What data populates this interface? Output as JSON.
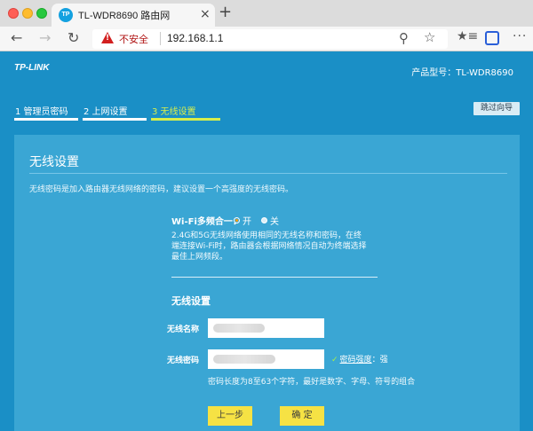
{
  "browser": {
    "tab_favicon_text": "TP",
    "tab_title": "TL-WDR8690 路由网",
    "tab_close": "×",
    "new_tab": "+",
    "security_label": "不安全",
    "url": "192.168.1.1",
    "icons": [
      "back-icon",
      "forward-icon",
      "reload-icon",
      "warning-icon",
      "zoom-icon",
      "star-icon",
      "favorites-icon",
      "extension-icon",
      "menu-icon"
    ]
  },
  "header": {
    "brand": "TP-LINK",
    "model": "产品型号：TL-WDR8690"
  },
  "stepper": {
    "steps": [
      {
        "label": "1 管理员密码",
        "status": "done"
      },
      {
        "label": "2 上网设置",
        "status": "done"
      },
      {
        "label": "3 无线设置",
        "status": "active"
      }
    ],
    "skip_label": "跳过向导"
  },
  "panel": {
    "title": "无线设置",
    "description": "无线密码是加入路由器无线网络的密码，建议设置一个高强度的无线密码。",
    "wifi_combo": {
      "label": "Wi-Fi多频合一：",
      "on_label": "开",
      "off_label": "关",
      "selected": "开"
    },
    "help_text": "2.4G和5G无线网络使用相同的无线名称和密码，在终端连接Wi-Fi时，路由器会根据网络情况自动为终端选择最佳上网频段。",
    "section_title": "无线设置",
    "ssid_label": "无线名称",
    "password_label": "无线密码",
    "strength_key": "密码强度",
    "strength_value": "：强",
    "password_hint": "密码长度为8至63个字符，最好是数字、字母、符号的组合",
    "prev_button": "上一步",
    "confirm_button": "确 定"
  },
  "colors": {
    "page_bg": "#1a8fc6",
    "panel_bg": "#3aa6d4",
    "active_step": "#d7ee4c",
    "button_bg": "#f6e244"
  }
}
